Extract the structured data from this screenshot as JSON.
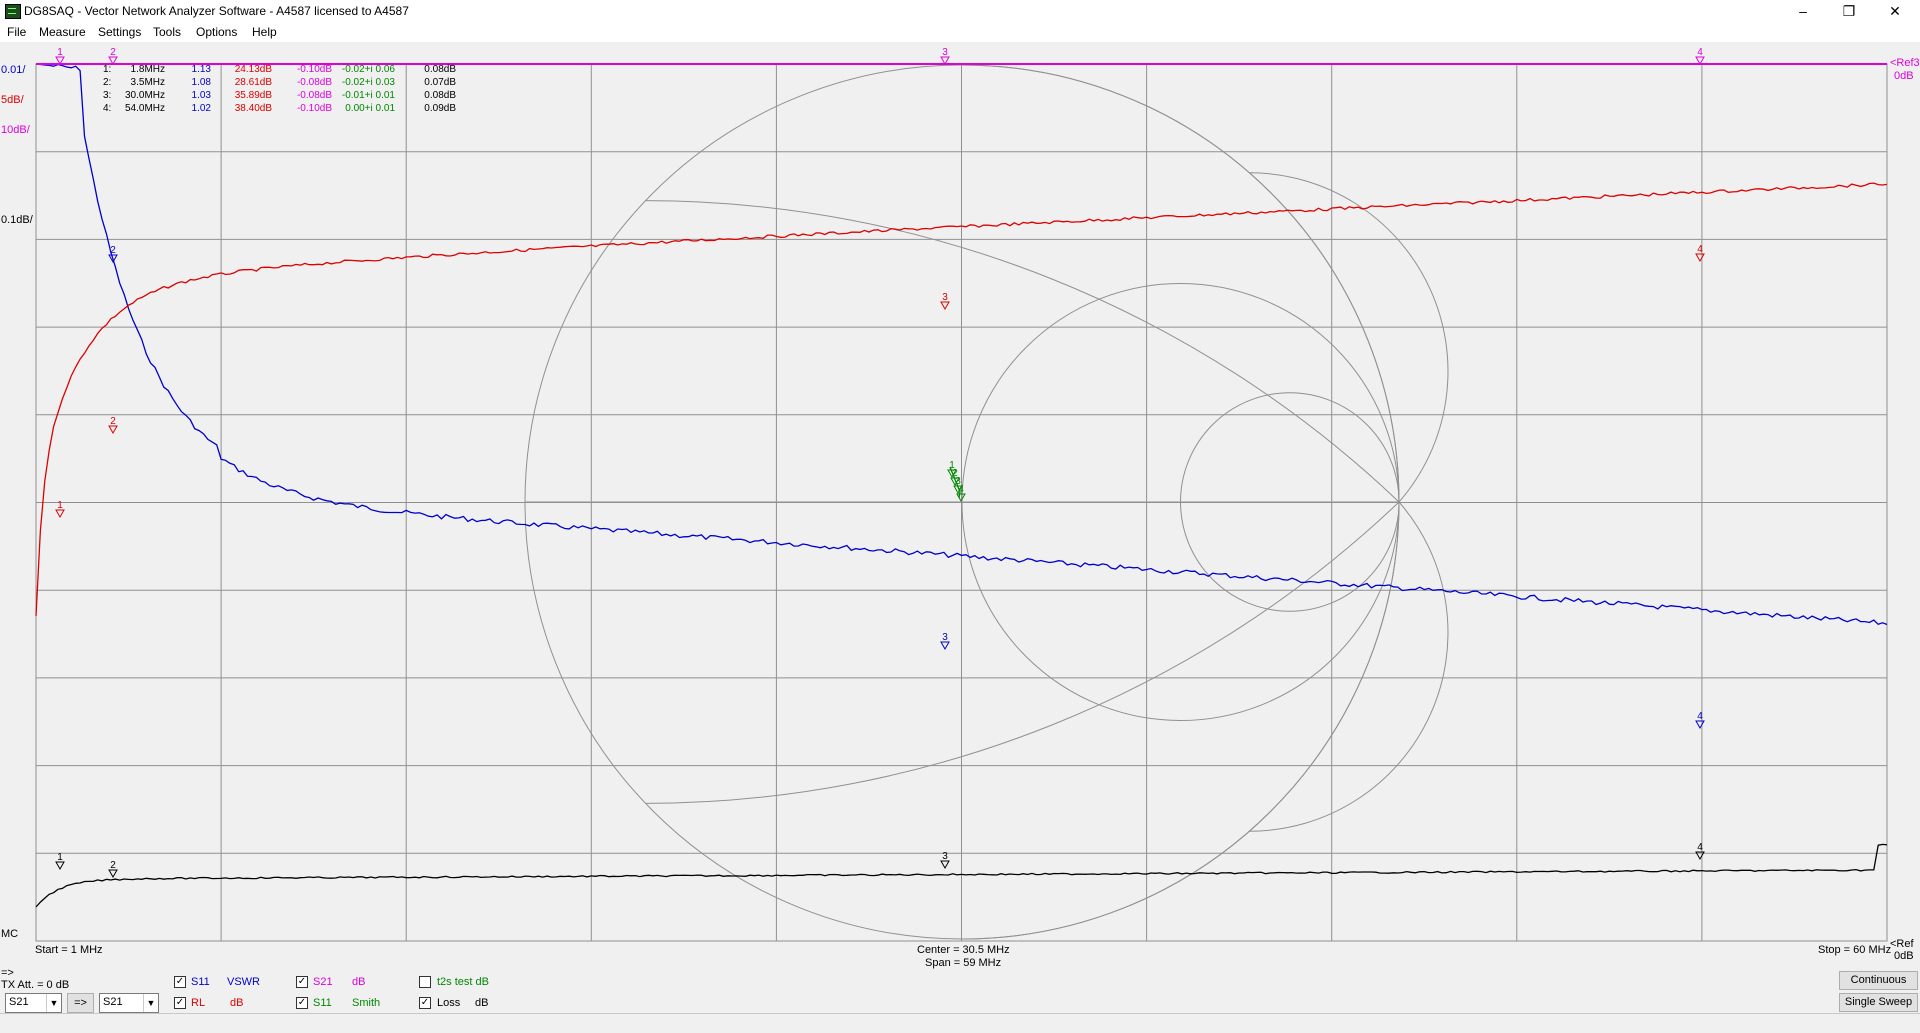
{
  "window": {
    "title": "DG8SAQ  -  Vector Network Analyzer Software  - A4587 licensed to A4587",
    "minimize": "–",
    "restore": "❐",
    "close": "✕"
  },
  "menu": [
    "File",
    "Measure",
    "Settings",
    "Tools",
    "Options",
    "Help"
  ],
  "scales": {
    "left": [
      "0.01/",
      "5dB/",
      "10dB/",
      "0.1dB/"
    ],
    "mc": "MC",
    "ref_top": "<Ref3",
    "ref_top_val": "0dB",
    "ref_bot": "<Ref",
    "ref_bot_val": "0dB"
  },
  "markers_table": [
    {
      "idx": "1:",
      "freq": "1.8MHz",
      "vswr": "1.13",
      "rl": "24.13dB",
      "s21": "-0.10dB",
      "z": "-0.02+i 0.06",
      "loss": "0.08dB"
    },
    {
      "idx": "2:",
      "freq": "3.5MHz",
      "vswr": "1.08",
      "rl": "28.61dB",
      "s21": "-0.08dB",
      "z": "-0.02+i 0.03",
      "loss": "0.07dB"
    },
    {
      "idx": "3:",
      "freq": "30.0MHz",
      "vswr": "1.03",
      "rl": "35.89dB",
      "s21": "-0.08dB",
      "z": "-0.01+i 0.01",
      "loss": "0.08dB"
    },
    {
      "idx": "4:",
      "freq": "54.0MHz",
      "vswr": "1.02",
      "rl": "38.40dB",
      "s21": "-0.10dB",
      "z": "0.00+i 0.01",
      "loss": "0.09dB"
    }
  ],
  "freq_axis": {
    "start": "Start = 1 MHz",
    "center": "Center = 30.5 MHz",
    "span": "Span = 59 MHz",
    "stop": "Stop = 60 MHz"
  },
  "colors": {
    "vswr": "#0000cc",
    "rl": "#dd0000",
    "s21": "#dd00dd",
    "smith": "#008800",
    "loss": "#000000",
    "grid": "#909090"
  },
  "controls": {
    "arrow": "=>",
    "tx_att": "TX Att.  = 0 dB",
    "combo1": "S21",
    "combo_btn": "=>",
    "combo2": "S21",
    "traces": [
      {
        "checked": "✓",
        "param": "S11",
        "fmt": "VSWR"
      },
      {
        "checked": "✓",
        "param": "RL",
        "fmt": "dB"
      },
      {
        "checked": "✓",
        "param": "S21",
        "fmt": "dB"
      },
      {
        "checked": "✓",
        "param": "S11",
        "fmt": "Smith"
      },
      {
        "checked": "",
        "param": "t2s test dB",
        "fmt": ""
      },
      {
        "checked": "✓",
        "param": "Loss",
        "fmt": "dB"
      }
    ],
    "continuous": "Continuous",
    "single_sweep": "Single Sweep"
  }
}
